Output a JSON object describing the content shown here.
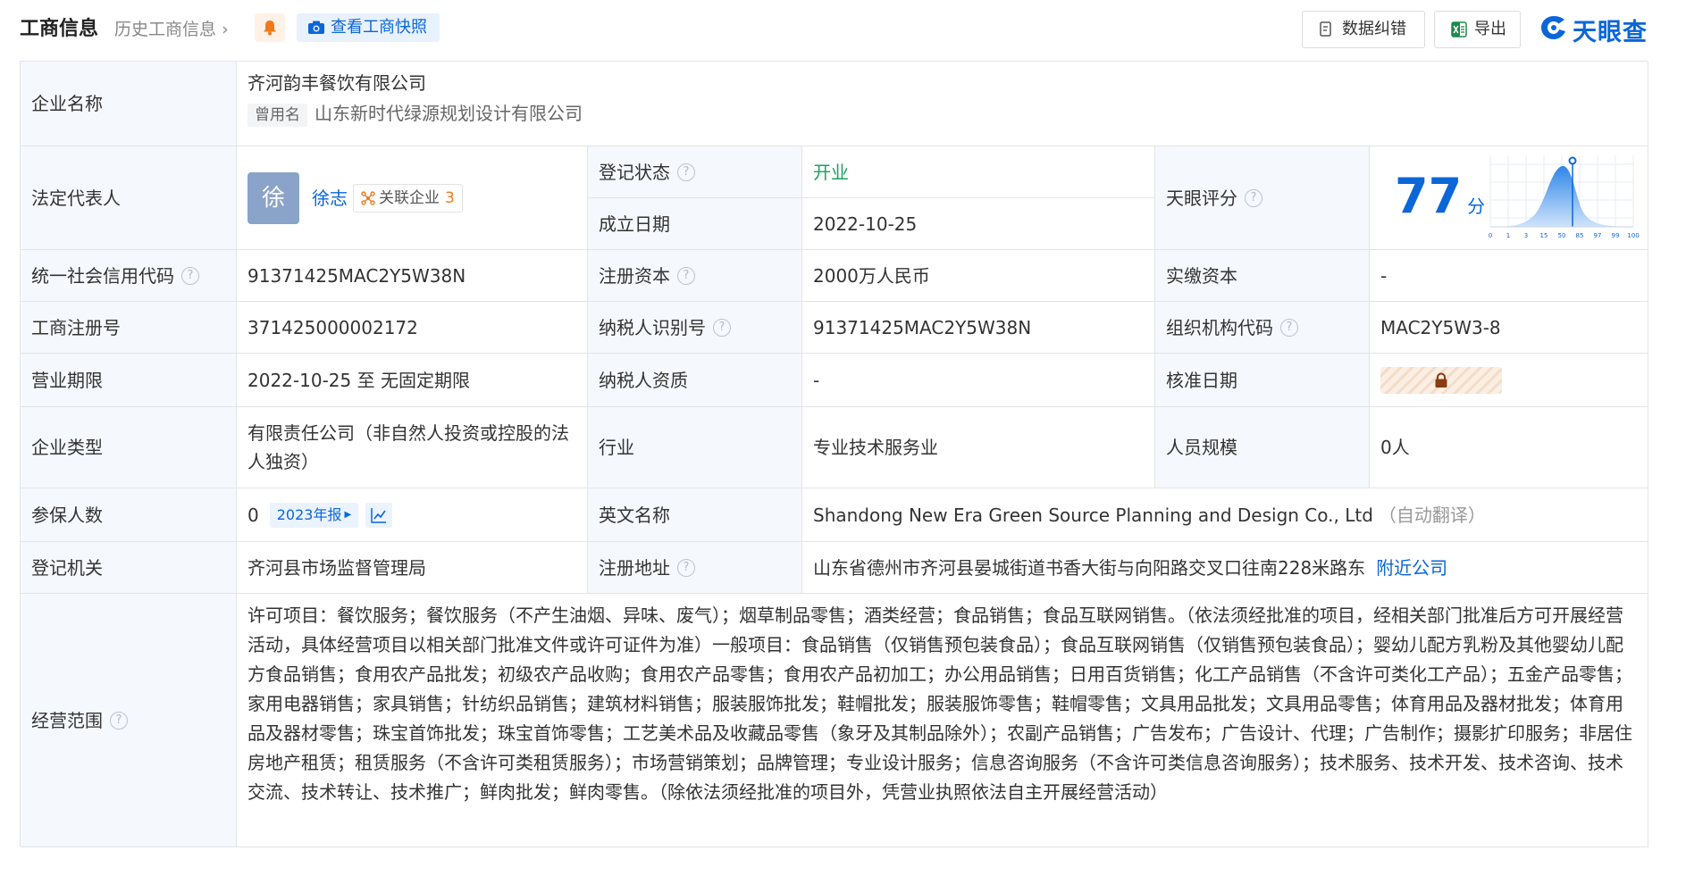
{
  "header": {
    "title": "工商信息",
    "history_link": "历史工商信息",
    "snapshot_button": "查看工商快照",
    "correct_button": "数据纠错",
    "export_button": "导出",
    "brand": "天眼查",
    "brand_color": "#0b66d8"
  },
  "rows": {
    "company_name": {
      "label": "企业名称",
      "value": "齐河韵丰餐饮有限公司",
      "former_tag": "曾用名",
      "former_value": "山东新时代绿源规划设计有限公司"
    },
    "legal_rep": {
      "label": "法定代表人",
      "avatar_char": "徐",
      "name": "徐志",
      "related_label": "关联企业",
      "related_count": "3"
    },
    "reg_status": {
      "label": "登记状态",
      "value": "开业",
      "color": "#1aa362"
    },
    "founded": {
      "label": "成立日期",
      "value": "2022-10-25"
    },
    "score": {
      "label": "天眼评分",
      "value": "77",
      "unit": "分",
      "axis_ticks": [
        "0",
        "1",
        "3",
        "15",
        "50",
        "85",
        "97",
        "99",
        "100"
      ]
    },
    "credit_code": {
      "label": "统一社会信用代码",
      "value": "91371425MAC2Y5W38N"
    },
    "reg_capital": {
      "label": "注册资本",
      "value": "2000万人民币"
    },
    "paid_capital": {
      "label": "实缴资本",
      "value": "-"
    },
    "reg_no": {
      "label": "工商注册号",
      "value": "371425000002172"
    },
    "taxpayer_id": {
      "label": "纳税人识别号",
      "value": "91371425MAC2Y5W38N"
    },
    "org_code": {
      "label": "组织机构代码",
      "value": "MAC2Y5W3-8"
    },
    "term": {
      "label": "营业期限",
      "value": "2022-10-25 至 无固定期限"
    },
    "taxpayer_qual": {
      "label": "纳税人资质",
      "value": "-"
    },
    "approve_date": {
      "label": "核准日期"
    },
    "company_type": {
      "label": "企业类型",
      "value": "有限责任公司（非自然人投资或控股的法人独资）"
    },
    "industry": {
      "label": "行业",
      "value": "专业技术服务业"
    },
    "staff_size": {
      "label": "人员规模",
      "value": "0人"
    },
    "insured": {
      "label": "参保人数",
      "value": "0",
      "report_tag": "2023年报"
    },
    "english_name": {
      "label": "英文名称",
      "value": "Shandong New Era Green Source Planning and Design Co., Ltd",
      "note": "（自动翻译）"
    },
    "authority": {
      "label": "登记机关",
      "value": "齐河县市场监督管理局"
    },
    "reg_address": {
      "label": "注册地址",
      "value": "山东省德州市齐河县晏城街道书香大街与向阳路交叉口往南228米路东",
      "nearby_link": "附近公司"
    },
    "scope": {
      "label": "经营范围",
      "value": "许可项目：餐饮服务；餐饮服务（不产生油烟、异味、废气）；烟草制品零售；酒类经营；食品销售；食品互联网销售。（依法须经批准的项目，经相关部门批准后方可开展经营活动，具体经营项目以相关部门批准文件或许可证件为准）一般项目：食品销售（仅销售预包装食品）；食品互联网销售（仅销售预包装食品）；婴幼儿配方乳粉及其他婴幼儿配方食品销售；食用农产品批发；初级农产品收购；食用农产品零售；食用农产品初加工；办公用品销售；日用百货销售；化工产品销售（不含许可类化工产品）；五金产品零售；家用电器销售；家具销售；针纺织品销售；建筑材料销售；服装服饰批发；鞋帽批发；服装服饰零售；鞋帽零售；文具用品批发；文具用品零售；体育用品及器材批发；体育用品及器材零售；珠宝首饰批发；珠宝首饰零售；工艺美术品及收藏品零售（象牙及其制品除外）；农副产品销售；广告发布；广告设计、代理；广告制作；摄影扩印服务；非居住房地产租赁；租赁服务（不含许可类租赁服务）；市场营销策划；品牌管理；专业设计服务；信息咨询服务（不含许可类信息咨询服务）；技术服务、技术开发、技术咨询、技术交流、技术转让、技术推广；鲜肉批发；鲜肉零售。（除依法须经批准的项目外，凭营业执照依法自主开展经营活动）"
    }
  }
}
